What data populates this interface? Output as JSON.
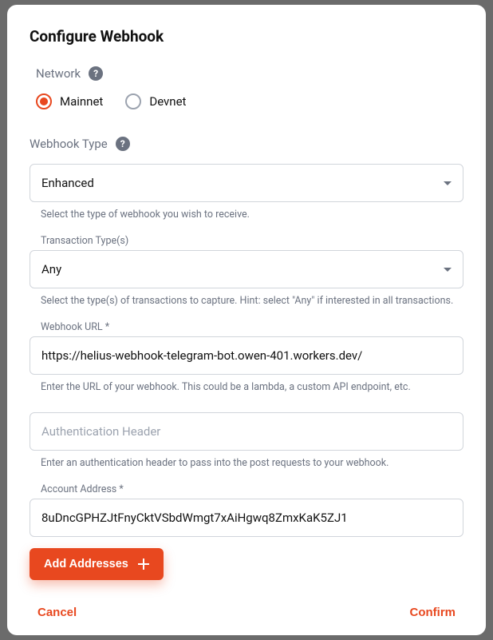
{
  "modal": {
    "title": "Configure Webhook"
  },
  "network": {
    "label": "Network",
    "options": {
      "mainnet": "Mainnet",
      "devnet": "Devnet"
    },
    "selected": "mainnet"
  },
  "webhookType": {
    "label": "Webhook Type",
    "value": "Enhanced",
    "hint": "Select the type of webhook you wish to receive."
  },
  "transactionType": {
    "label": "Transaction Type(s)",
    "value": "Any",
    "hint": "Select the type(s) of transactions to capture. Hint: select \"Any\" if interested in all transactions."
  },
  "webhookUrl": {
    "label": "Webhook URL *",
    "value": "https://helius-webhook-telegram-bot.owen-401.workers.dev/",
    "hint": "Enter the URL of your webhook. This could be a lambda, a custom API endpoint, etc."
  },
  "authHeader": {
    "placeholder": "Authentication Header",
    "value": "",
    "hint": "Enter an authentication header to pass into the post requests to your webhook."
  },
  "accountAddress": {
    "label": "Account Address *",
    "value": "8uDncGPHZJtFnyCktVSbdWmgt7xAiHgwq8ZmxKaK5ZJ1"
  },
  "buttons": {
    "addAddresses": "Add Addresses",
    "cancel": "Cancel",
    "confirm": "Confirm"
  }
}
